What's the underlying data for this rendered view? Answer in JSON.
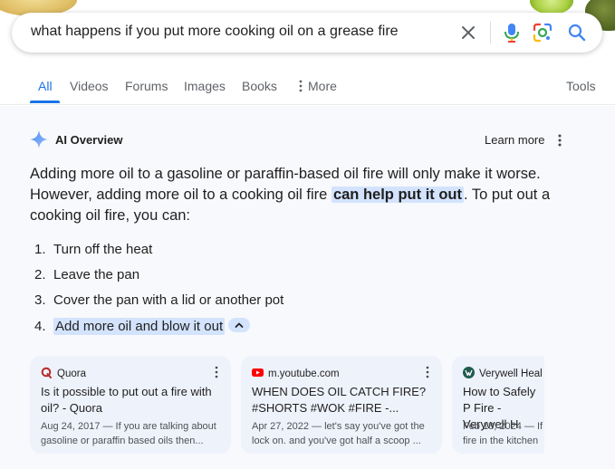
{
  "search": {
    "query": "what happens if you put more cooking oil on a grease fire"
  },
  "tabs": [
    {
      "label": "All"
    },
    {
      "label": "Videos"
    },
    {
      "label": "Forums"
    },
    {
      "label": "Images"
    },
    {
      "label": "Books"
    },
    {
      "label": "More"
    }
  ],
  "tools_label": "Tools",
  "ai_overview": {
    "title": "AI Overview",
    "learn_more": "Learn more",
    "para_part1": "Adding more oil to a gasoline or paraffin-based oil fire will only make it worse. However, adding more oil to a cooking oil fire ",
    "para_highlight": "can help put it out",
    "para_part2": ". To put out a cooking oil fire, you can:",
    "steps": [
      {
        "num": "1.",
        "text": "Turn off the heat"
      },
      {
        "num": "2.",
        "text": "Leave the pan"
      },
      {
        "num": "3.",
        "text": "Cover the pan with a lid or another pot"
      },
      {
        "num": "4.",
        "text": "Add more oil and blow it out"
      }
    ]
  },
  "sources": [
    {
      "site": "Quora",
      "title": "Is it possible to put out a fire with oil? - Quora",
      "snippet": "Aug 24, 2017 — If you are talking about gasoline or paraffin based oils then..."
    },
    {
      "site": "m.youtube.com",
      "title": "WHEN DOES OIL CATCH FIRE? #SHORTS #WOK #FIRE -...",
      "snippet": "Apr 27, 2022 — let's say you've got the lock on. and you've got half a scoop ..."
    },
    {
      "site": "Verywell Heal",
      "title": "How to Safely P Fire - Verywell H",
      "snippet": "Feb 18, 2024 — If fire in the kitchen"
    }
  ],
  "colors": {
    "accent": "#1a73e8",
    "highlight": "#d3e3fd",
    "panel_bg": "#f8f9fc",
    "card_bg": "#eef2fb"
  },
  "icons": [
    "clear-icon",
    "mic-icon",
    "lens-icon",
    "search-icon",
    "more-dots-icon",
    "sparkle-icon",
    "kebab-icon",
    "chevron-up-icon",
    "quora-logo",
    "youtube-logo",
    "verywell-logo"
  ]
}
